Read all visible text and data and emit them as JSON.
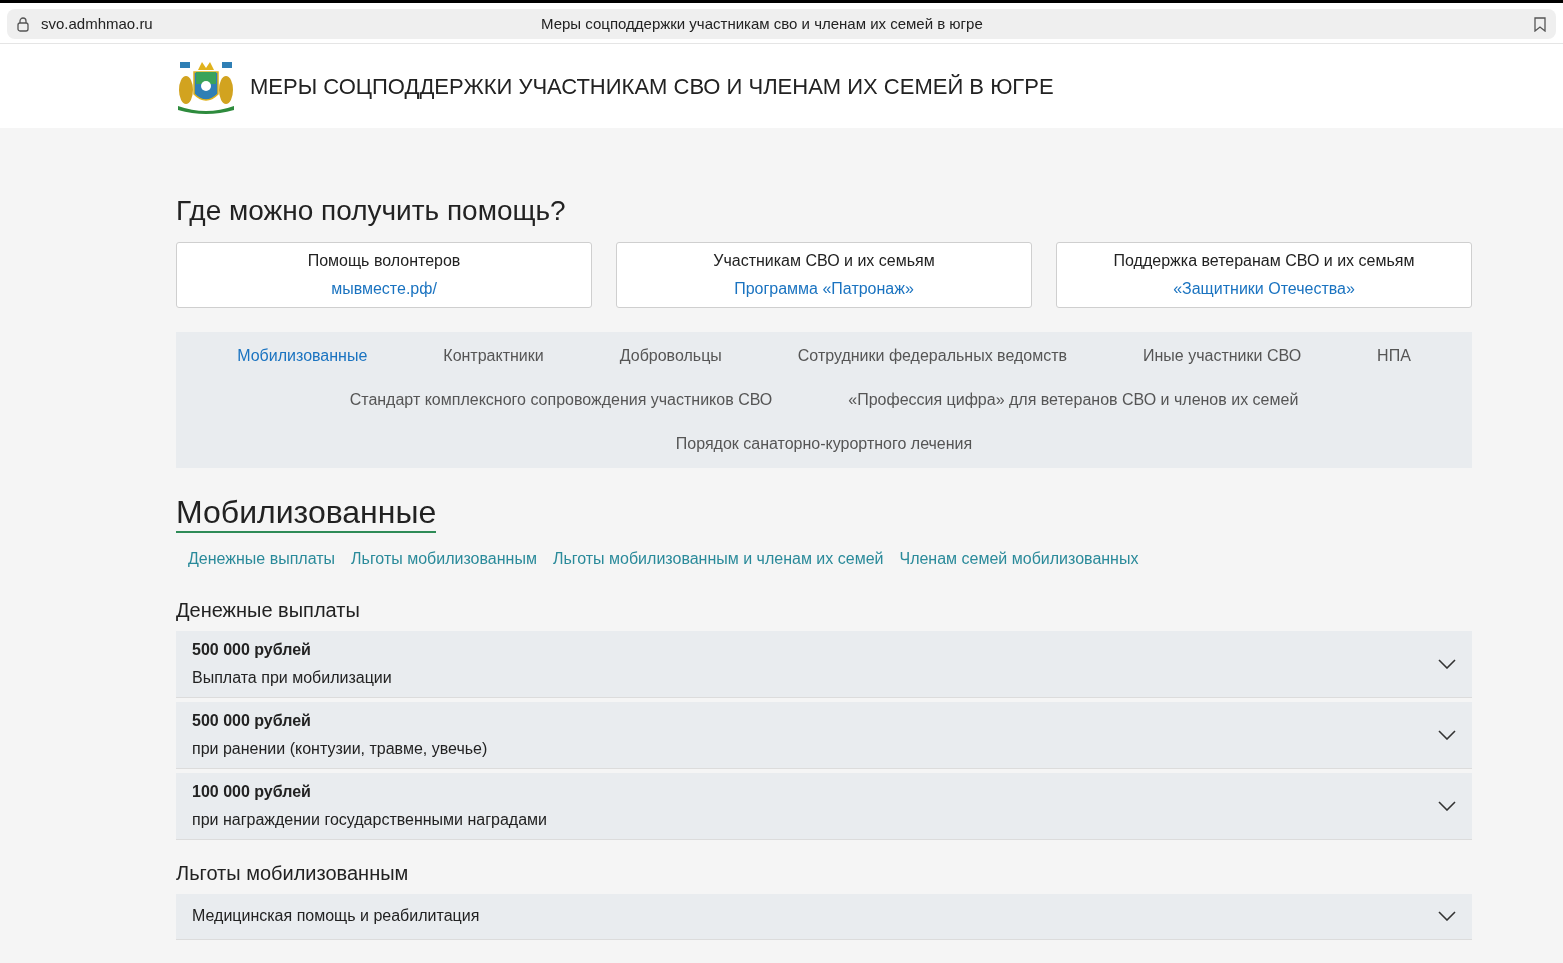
{
  "browser": {
    "url": "svo.admhmao.ru",
    "title": "Меры соцподдержки участникам сво и членам их семей в югре"
  },
  "header": {
    "title": "МЕРЫ СОЦПОДДЕРЖКИ УЧАСТНИКАМ СВО И ЧЛЕНАМ ИХ СЕМЕЙ В ЮГРЕ"
  },
  "help": {
    "heading": "Где можно получить помощь?",
    "cards": [
      {
        "label": "Помощь волонтеров",
        "link": "мывместе.рф/"
      },
      {
        "label": "Участникам СВО и их семьям",
        "link": "Программа «Патронаж»"
      },
      {
        "label": "Поддержка ветеранам СВО и их семьям",
        "link": "«Защитники Отечества»"
      }
    ]
  },
  "nav": {
    "links": [
      {
        "label": "Мобилизованные",
        "selected": true
      },
      {
        "label": "Контрактники",
        "selected": false
      },
      {
        "label": "Добровольцы",
        "selected": false
      },
      {
        "label": "Сотрудники федеральных ведомств",
        "selected": false
      },
      {
        "label": "Иные участники СВО",
        "selected": false
      },
      {
        "label": "НПА",
        "selected": false
      },
      {
        "label": "Стандарт комплексного сопровождения участников СВО",
        "selected": false
      },
      {
        "label": "«Профессия цифра» для ветеранов СВО и членов их семей",
        "selected": false
      },
      {
        "label": "Порядок санаторно-курортного лечения",
        "selected": false
      }
    ]
  },
  "section": {
    "title": "Мобилизованные",
    "anchors": [
      "Денежные выплаты",
      "Льготы мобилизованным",
      "Льготы мобилизованным и членам их семей",
      "Членам семей мобилизованных"
    ],
    "groups": [
      {
        "title": "Денежные выплаты",
        "items": [
          {
            "amount": "500 000 рублей",
            "text": "Выплата при мобилизации",
            "expanded": false
          },
          {
            "amount": "500 000 рублей",
            "text": "при ранении (контузии, травме, увечье)",
            "expanded": false
          },
          {
            "amount": "100 000 рублей",
            "text": "при награждении государственными наградами",
            "expanded": false
          }
        ]
      },
      {
        "title": "Льготы мобилизованным",
        "items": [
          {
            "text": "Медицинская помощь и реабилитация",
            "expanded": false
          }
        ]
      }
    ]
  }
}
